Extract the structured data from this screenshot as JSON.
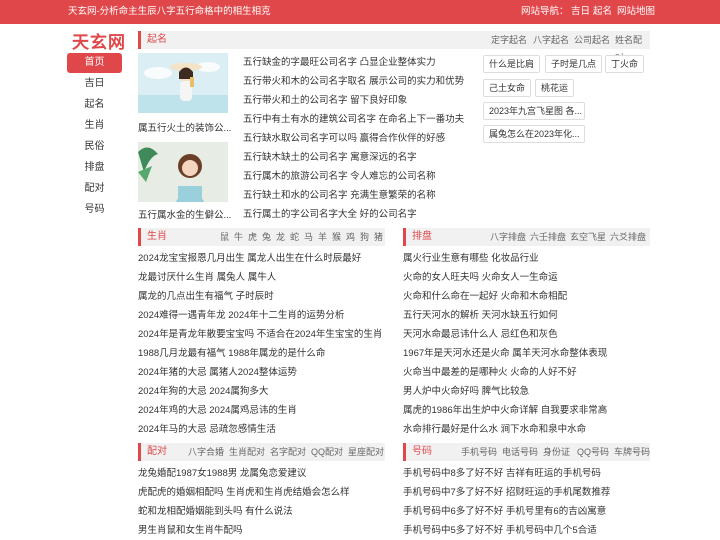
{
  "topbar": {
    "description": "天玄网-分析命主生辰八字五行命格中的相生相克",
    "nav_label": "网站导航：",
    "links": [
      "吉日",
      "起名",
      "网站地图"
    ]
  },
  "logo": "天玄网",
  "sidebar": [
    "首页",
    "吉日",
    "起名",
    "生肖",
    "民俗",
    "排盘",
    "配对",
    "号码"
  ],
  "qiming": {
    "title": "起名",
    "links": [
      "定字起名",
      "八字起名",
      "公司起名",
      "姓名配对"
    ],
    "thumbs": [
      {
        "caption": "属五行火土的装饰公..."
      },
      {
        "caption": "五行属水金的生僻公..."
      }
    ],
    "lines": [
      "五行缺金的字最旺公司名字 凸显企业整体实力",
      "五行带火和木的公司名字取名 展示公司的实力和优势",
      "五行带火和土的公司名字 留下良好印象",
      "五行中有土有水的建筑公司名字 在命名上下一番功夫",
      "五行缺水取公司名字可以吗 赢得合作伙伴的好感",
      "五行缺木缺土的公司名字 寓意深远的名字",
      "五行属木的旅游公司名字 令人难忘的公司名称",
      "五行缺土和水的公司名字 充满生意繁荣的名称",
      "五行属土的字公司名字大全 好的公司名字"
    ],
    "tags": [
      "什么是比肩",
      "子时是几点",
      "丁火命",
      "己土女命",
      "桃花运",
      "2023年九宫飞星图 各...",
      "属兔怎么在2023年化..."
    ]
  },
  "shengxiao": {
    "title": "生肖",
    "links": [
      "鼠",
      "牛",
      "虎",
      "兔",
      "龙",
      "蛇",
      "马",
      "羊",
      "猴",
      "鸡",
      "狗",
      "猪"
    ],
    "lines": [
      "2024龙宝宝报恩几月出生 属龙人出生在什么时辰最好",
      "龙最讨厌什么生肖 属兔人 属牛人",
      "属龙的几点出生有福气 子时辰时",
      "2024难得一遇青年龙 2024年十二生肖的运势分析",
      "2024年是青龙年散要宝宝吗 不适合在2024年生宝宝的生肖",
      "1988几月龙最有福气 1988年属龙的是什么命",
      "2024年猪的大忌 属猪人2024整体运势",
      "2024年狗的大忌 2024属狗多大",
      "2024年鸡的大忌 2024属鸡忌讳的生肖",
      "2024年马的大忌 忌疏忽感情生活"
    ]
  },
  "paipan": {
    "title": "排盘",
    "links": [
      "八字排盘",
      "六壬排盘",
      "玄空飞星",
      "六爻排盘"
    ],
    "lines": [
      "属火行业生意有哪些 化妆品行业",
      "火命的女人旺夫吗 火命女人一生命运",
      "火命和什么命在一起好 火命和木命相配",
      "五行天河水的解析 天河水缺五行如何",
      "天河水命最忌讳什么人 忌红色和灰色",
      "1967年是天河水还是火命 属羊天河水命整体表现",
      "火命当中最差的是哪种火 火命的人好不好",
      "男人炉中火命好吗 脾气比较急",
      "属虎的1986年出生炉中火命详解 自我要求非常高",
      "水命排行最好是什么水 涧下水命和泉中水命"
    ]
  },
  "peidui": {
    "title": "配对",
    "links": [
      "八字合婚",
      "生肖配对",
      "名字配对",
      "QQ配对",
      "星座配对"
    ],
    "lines": [
      "龙兔婚配1987女1988男 龙属兔恋爱建议",
      "虎配虎的婚姻相配吗 生肖虎和生肖虎结婚会怎么样",
      "蛇和龙相配婚姻能到头吗 有什么说法",
      "男生肖鼠和女生肖牛配吗"
    ]
  },
  "haoma": {
    "title": "号码",
    "links": [
      "手机号码",
      "电话号码",
      "身份证",
      "QQ号码",
      "车牌号码"
    ],
    "lines": [
      "手机号码中8多了好不好 吉祥有旺运的手机号码",
      "手机号码中7多了好不好 招财旺运的手机尾数推荐",
      "手机号码中6多了好不好 手机号里有6的吉凶寓意",
      "手机号码中5多了好不好 手机号码中几个5合适"
    ]
  }
}
